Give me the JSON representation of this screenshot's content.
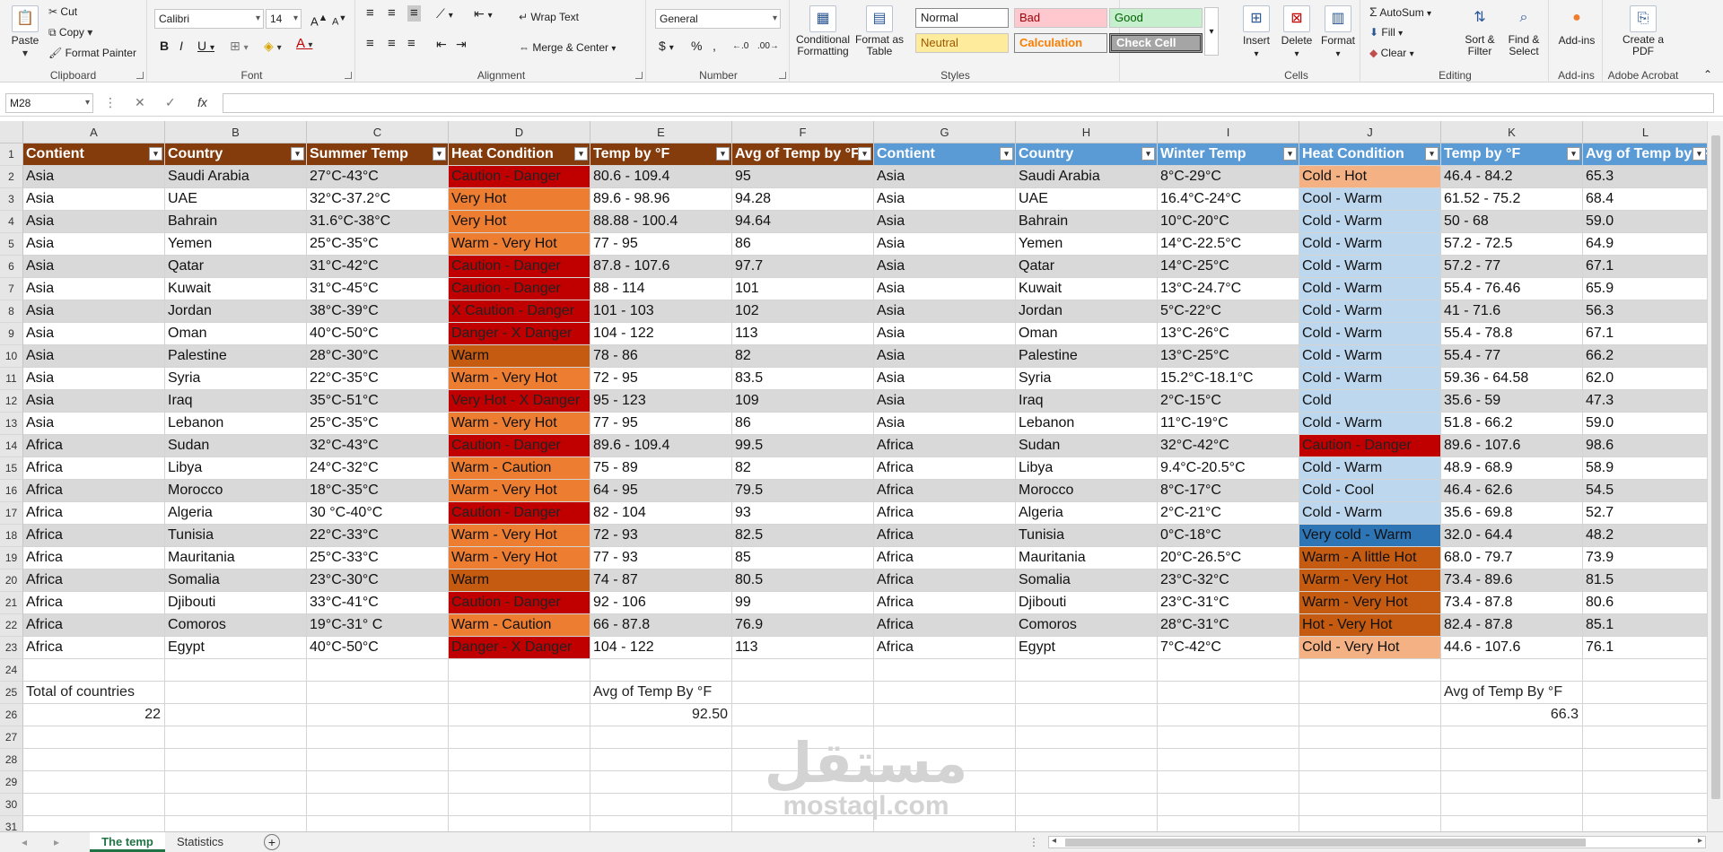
{
  "ribbon": {
    "clipboard": {
      "label": "Clipboard",
      "paste": "Paste",
      "cut": "Cut",
      "copy": "Copy",
      "format_painter": "Format Painter"
    },
    "font": {
      "label": "Font",
      "name": "Calibri",
      "size": "14"
    },
    "alignment": {
      "label": "Alignment",
      "wrap_text": "Wrap Text",
      "merge_center": "Merge & Center"
    },
    "number": {
      "label": "Number",
      "format": "General"
    },
    "styles": {
      "label": "Styles",
      "conditional": "Conditional Formatting",
      "format_table": "Format as Table",
      "normal": "Normal",
      "bad": "Bad",
      "good": "Good",
      "neutral": "Neutral",
      "calculation": "Calculation",
      "check_cell": "Check Cell"
    },
    "cells": {
      "label": "Cells",
      "insert": "Insert",
      "delete": "Delete",
      "format": "Format"
    },
    "editing": {
      "label": "Editing",
      "autosum": "AutoSum",
      "fill": "Fill",
      "clear": "Clear",
      "sort": "Sort & Filter",
      "find": "Find & Select"
    },
    "addins": {
      "label": "Add-ins",
      "btn": "Add-ins"
    },
    "acrobat": {
      "label": "Adobe Acrobat",
      "btn": "Create a PDF"
    }
  },
  "formula": {
    "namebox": "M28",
    "content": ""
  },
  "columns": [
    "A",
    "B",
    "C",
    "D",
    "E",
    "F",
    "G",
    "H",
    "I",
    "J",
    "K",
    "L"
  ],
  "headers_left": [
    "Contient",
    "Country",
    "Summer Temp",
    "Heat Condition",
    "Temp by °F",
    "Avg of Temp by °F"
  ],
  "headers_right": [
    "Contient",
    "Country",
    "Winter Temp",
    "Heat Condition",
    "Temp by °F",
    "Avg of Temp by °F"
  ],
  "rows": [
    [
      "Asia",
      "Saudi Arabia",
      "27°C-43°C",
      "Caution - Danger",
      "80.6 - 109.4",
      "95",
      "Asia",
      "Saudi Arabia",
      "8°C-29°C",
      "Cold - Hot",
      "46.4 - 84.2",
      "65.3"
    ],
    [
      "Asia",
      "UAE",
      "32°C-37.2°C",
      "Very Hot",
      "89.6 - 98.96",
      "94.28",
      "Asia",
      "UAE",
      "16.4°C-24°C",
      "Cool - Warm",
      "61.52 - 75.2",
      "68.4"
    ],
    [
      "Asia",
      "Bahrain",
      "31.6°C-38°C",
      "Very Hot",
      "88.88 - 100.4",
      "94.64",
      "Asia",
      "Bahrain",
      "10°C-20°C",
      "Cold - Warm",
      "50 - 68",
      "59.0"
    ],
    [
      "Asia",
      "Yemen",
      "25°C-35°C",
      "Warm - Very Hot",
      "77 - 95",
      "86",
      "Asia",
      "Yemen",
      "14°C-22.5°C",
      "Cold - Warm",
      "57.2 - 72.5",
      "64.9"
    ],
    [
      "Asia",
      "Qatar",
      "31°C-42°C",
      "Caution - Danger",
      "87.8 - 107.6",
      "97.7",
      "Asia",
      "Qatar",
      "14°C-25°C",
      "Cold - Warm",
      "57.2 - 77",
      "67.1"
    ],
    [
      "Asia",
      "Kuwait",
      "31°C-45°C",
      "Caution - Danger",
      "88 - 114",
      "101",
      "Asia",
      "Kuwait",
      "13°C-24.7°C",
      "Cold - Warm",
      "55.4 - 76.46",
      "65.9"
    ],
    [
      "Asia",
      "Jordan",
      "38°C-39°C",
      "X Caution - Danger",
      "101 - 103",
      "102",
      "Asia",
      "Jordan",
      "5°C-22°C",
      "Cold - Warm",
      "41 - 71.6",
      "56.3"
    ],
    [
      "Asia",
      "Oman",
      "40°C-50°C",
      "Danger - X Danger",
      "104 - 122",
      "113",
      "Asia",
      "Oman",
      "13°C-26°C",
      "Cold - Warm",
      "55.4 - 78.8",
      "67.1"
    ],
    [
      "Asia",
      "Palestine",
      "28°C-30°C",
      "Warm",
      "78 - 86",
      "82",
      "Asia",
      "Palestine",
      "13°C-25°C",
      "Cold - Warm",
      "55.4 - 77",
      "66.2"
    ],
    [
      "Asia",
      "Syria",
      "22°C-35°C",
      "Warm - Very Hot",
      "72 - 95",
      "83.5",
      "Asia",
      "Syria",
      "15.2°C-18.1°C",
      "Cold - Warm",
      "59.36 - 64.58",
      "62.0"
    ],
    [
      "Asia",
      "Iraq",
      "35°C-51°C",
      "Very Hot - X Danger",
      "95 - 123",
      "109",
      "Asia",
      "Iraq",
      "2°C-15°C",
      "Cold",
      "35.6 - 59",
      "47.3"
    ],
    [
      "Asia",
      "Lebanon",
      "25°C-35°C",
      "Warm - Very Hot",
      "77 - 95",
      "86",
      "Asia",
      "Lebanon",
      "11°C-19°C",
      "Cold - Warm",
      "51.8 - 66.2",
      "59.0"
    ],
    [
      "Africa",
      "Sudan",
      "32°C-43°C",
      "Caution - Danger",
      "89.6 - 109.4",
      "99.5",
      "Africa",
      "Sudan",
      "32°C-42°C",
      "Caution - Danger",
      "89.6 - 107.6",
      "98.6"
    ],
    [
      "Africa",
      "Libya",
      "24°C-32°C",
      "Warm - Caution",
      "75 - 89",
      "82",
      "Africa",
      "Libya",
      "9.4°C-20.5°C",
      "Cold - Warm",
      "48.9 - 68.9",
      "58.9"
    ],
    [
      "Africa",
      "Morocco",
      "18°C-35°C",
      "Warm - Very Hot",
      "64 - 95",
      "79.5",
      "Africa",
      "Morocco",
      "8°C-17°C",
      "Cold - Cool",
      "46.4 - 62.6",
      "54.5"
    ],
    [
      "Africa",
      "Algeria",
      "30 °C-40°C",
      "Caution - Danger",
      "82 - 104",
      "93",
      "Africa",
      "Algeria",
      "2°C-21°C",
      "Cold - Warm",
      "35.6 - 69.8",
      "52.7"
    ],
    [
      "Africa",
      "Tunisia",
      "22°C-33°C",
      "Warm - Very Hot",
      "72 - 93",
      "82.5",
      "Africa",
      "Tunisia",
      "0°C-18°C",
      "Very cold - Warm",
      "32.0 - 64.4",
      "48.2"
    ],
    [
      "Africa",
      "Mauritania",
      "25°C-33°C",
      "Warm - Very Hot",
      "77 - 93",
      "85",
      "Africa",
      "Mauritania",
      "20°C-26.5°C",
      "Warm - A little Hot",
      "68.0 - 79.7",
      "73.9"
    ],
    [
      "Africa",
      "Somalia",
      "23°C-30°C",
      "Warm",
      "74 - 87",
      "80.5",
      "Africa",
      "Somalia",
      "23°C-32°C",
      "Warm - Very Hot",
      "73.4 - 89.6",
      "81.5"
    ],
    [
      "Africa",
      "Djibouti",
      "33°C-41°C",
      "Caution - Danger",
      "92 - 106",
      "99",
      "Africa",
      "Djibouti",
      "23°C-31°C",
      "Warm - Very Hot",
      "73.4 - 87.8",
      "80.6"
    ],
    [
      "Africa",
      "Comoros",
      "19°C-31° C",
      "Warm - Caution",
      "66 - 87.8",
      "76.9",
      "Africa",
      "Comoros",
      "28°C-31°C",
      "Hot - Very Hot",
      "82.4 - 87.8",
      "85.1"
    ],
    [
      "Africa",
      "Egypt",
      "40°C-50°C",
      "Danger - X Danger",
      "104 - 122",
      "113",
      "Africa",
      "Egypt",
      "7°C-42°C",
      "Cold - Very Hot",
      "44.6 - 107.6",
      "76.1"
    ]
  ],
  "summary": {
    "total_label": "Total of countries",
    "total_value": "22",
    "avg_label_left": "Avg of Temp By °F",
    "avg_value_left": "92.50",
    "avg_label_right": "Avg of Temp By °F",
    "avg_value_right": "66.3"
  },
  "sheets": [
    "The temp",
    "Statistics"
  ],
  "active_sheet": "The temp",
  "watermark": {
    "arabic": "مستقل",
    "latin": "mostaql.com"
  },
  "colors": {
    "header_left": "#843c0c",
    "header_right": "#5b9bd5",
    "band": "#d9d9d9",
    "dark_red": "#c00000",
    "orange": "#ed7d31",
    "burnt": "#c55a11",
    "light_orange": "#f4b183",
    "light_blue": "#bdd7ee",
    "blue": "#2e75b6",
    "excel_green": "#217346"
  }
}
